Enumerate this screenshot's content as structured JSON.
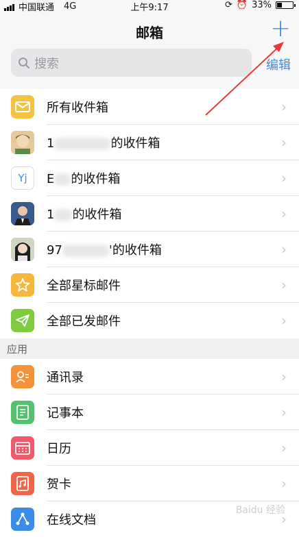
{
  "status_bar": {
    "carrier": "中国联通",
    "network": "4G",
    "time": "上午9:17",
    "battery": "33%",
    "battery_level": 0.33
  },
  "nav": {
    "title": "邮箱",
    "add_icon": "+",
    "edit_label": "编辑"
  },
  "search": {
    "placeholder": "搜索"
  },
  "mailboxes": [
    {
      "label": "所有收件箱",
      "icon": "envelope-icon",
      "color": "#f5c242"
    },
    {
      "label_prefix": "1",
      "label_suffix": "的收件箱",
      "icon": "avatar-icon",
      "color": "#c9a27e"
    },
    {
      "label_prefix": "E",
      "label_suffix": "的收件箱",
      "icon": "yj-logo-icon",
      "color": "#ffffff"
    },
    {
      "label_prefix": "1",
      "label_suffix": "的收件箱",
      "icon": "avatar-icon",
      "color": "#3b5a8c"
    },
    {
      "label_prefix": "97",
      "label_suffix": "'的收件箱",
      "icon": "avatar-icon",
      "color": "#5d6b56"
    },
    {
      "label": "全部星标邮件",
      "icon": "star-icon",
      "color": "#f5b83d"
    },
    {
      "label": "全部已发邮件",
      "icon": "sent-icon",
      "color": "#7fcd3f"
    }
  ],
  "apps_section": {
    "title": "应用"
  },
  "apps": [
    {
      "label": "通讯录",
      "icon": "contacts-icon",
      "color": "#f4923a"
    },
    {
      "label": "记事本",
      "icon": "notes-icon",
      "color": "#53c26f"
    },
    {
      "label": "日历",
      "icon": "calendar-icon",
      "color": "#f15a6b"
    },
    {
      "label": "贺卡",
      "icon": "card-icon",
      "color": "#f06548"
    },
    {
      "label": "在线文档",
      "icon": "docs-icon",
      "color": "#3a8ce9"
    }
  ],
  "watermark": "Baidu 经验"
}
